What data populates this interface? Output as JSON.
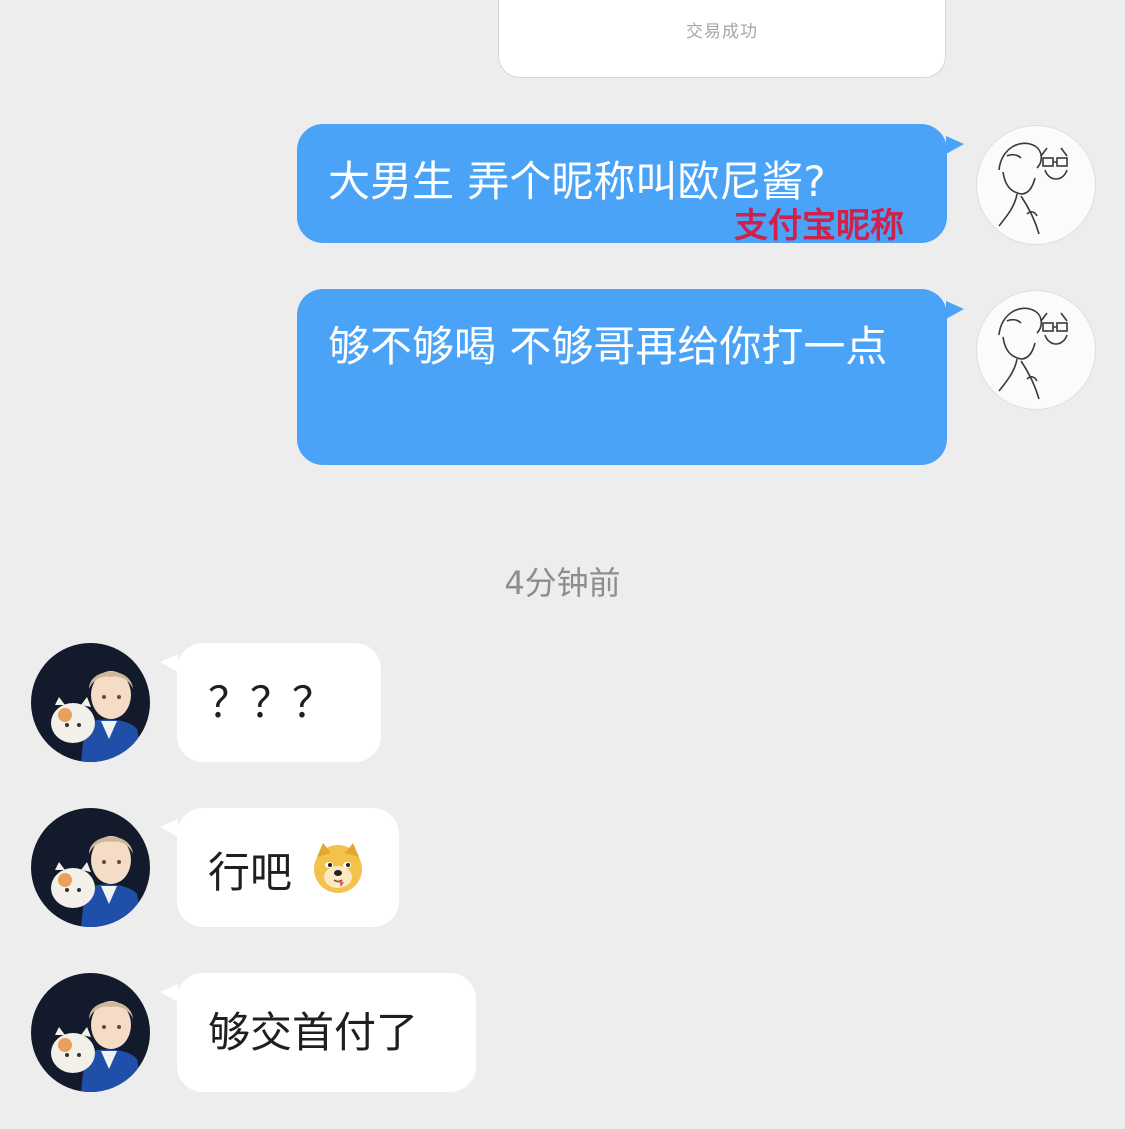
{
  "transaction_card": {
    "status_text": "交易成功"
  },
  "messages_out": [
    {
      "text": "大男生 弄个昵称叫欧尼酱?",
      "annotation": "支付宝昵称"
    },
    {
      "text": "够不够喝 不够哥再给你打一点"
    }
  ],
  "timestamp": "4分钟前",
  "messages_in": [
    {
      "text": "？？？"
    },
    {
      "text": "行吧",
      "emoji": "doge-emoji"
    },
    {
      "text": "够交首付了"
    }
  ],
  "avatars": {
    "self": "sketch-avatar",
    "other": "anime-avatar"
  },
  "colors": {
    "background": "#ededed",
    "outgoing_bubble": "#4aa3f7",
    "incoming_bubble": "#ffffff",
    "annotation": "#d0214a"
  }
}
